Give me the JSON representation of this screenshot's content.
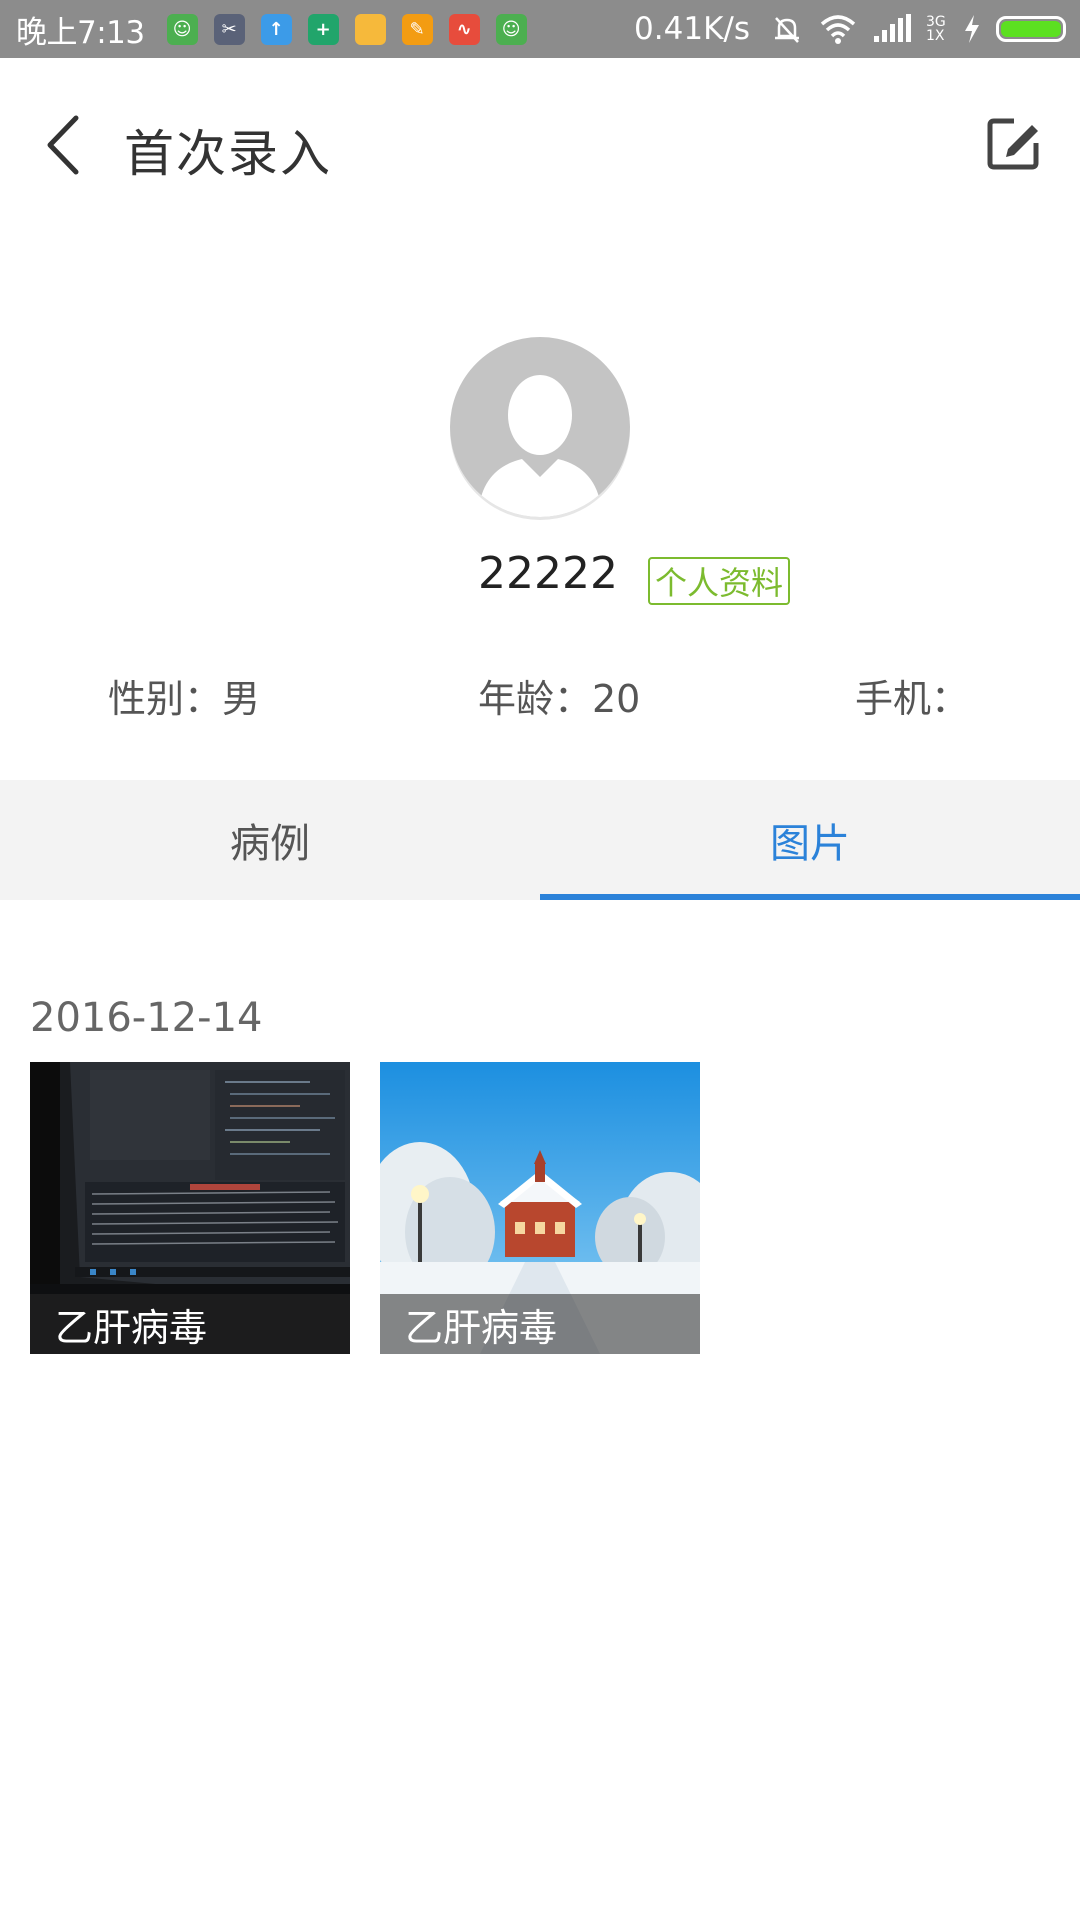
{
  "status_bar": {
    "time": "晚上7:13",
    "net_speed": "0.41K/s",
    "network_type": "3G\n1X",
    "battery_level": 1.0,
    "notification_icons": [
      "android-icon",
      "scissors-icon",
      "upload-icon",
      "shield-icon",
      "folder-icon",
      "brush-icon",
      "chart-icon",
      "android-icon"
    ]
  },
  "header": {
    "title": "首次录入"
  },
  "profile": {
    "name": "22222",
    "profile_tag": "个人资料",
    "gender": "性别：男",
    "age": "年龄：20",
    "phone": "手机："
  },
  "tabs": [
    {
      "label": "病例",
      "active": false
    },
    {
      "label": "图片",
      "active": true
    }
  ],
  "gallery": {
    "date": "2016-12-14",
    "photos": [
      {
        "caption": "乙肝病毒"
      },
      {
        "caption": "乙肝病毒"
      }
    ]
  },
  "colors": {
    "accent": "#2b82d9",
    "tag_green": "#7cbb2f",
    "status_bar": "#8c8c8c"
  }
}
